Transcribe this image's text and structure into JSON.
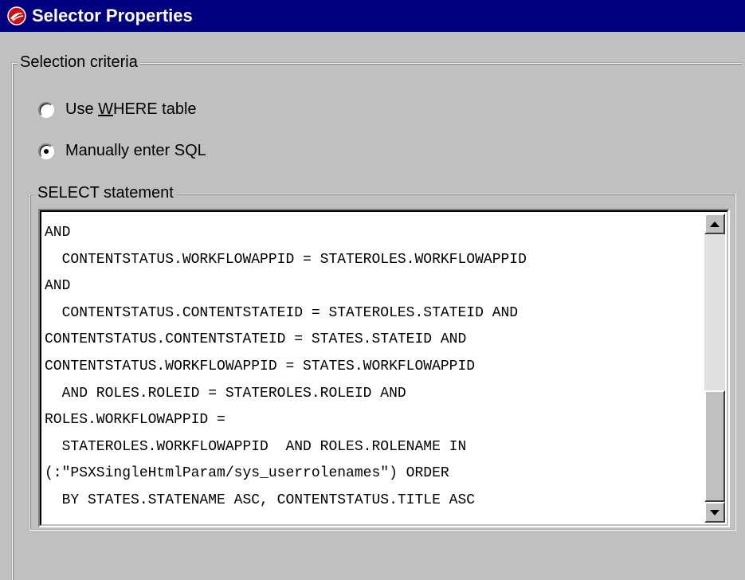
{
  "window": {
    "title": "Selector Properties",
    "icon": "app-logo-icon",
    "title_bar_color": "#000080"
  },
  "selection_criteria": {
    "group_label": "Selection criteria",
    "options": [
      {
        "label_prefix": "Use ",
        "label_mnemonic": "W",
        "label_suffix": "HERE table",
        "checked": false
      },
      {
        "label": "Manually enter SQL",
        "checked": true
      }
    ]
  },
  "select_statement": {
    "group_label": "SELECT statement",
    "lines": [
      "AND",
      "  CONTENTSTATUS.WORKFLOWAPPID = STATEROLES.WORKFLOWAPPID",
      "AND",
      "  CONTENTSTATUS.CONTENTSTATEID = STATEROLES.STATEID AND",
      "CONTENTSTATUS.CONTENTSTATEID = STATES.STATEID AND",
      "CONTENTSTATUS.WORKFLOWAPPID = STATES.WORKFLOWAPPID",
      "  AND ROLES.ROLEID = STATEROLES.ROLEID AND",
      "ROLES.WORKFLOWAPPID =",
      "  STATEROLES.WORKFLOWAPPID  AND ROLES.ROLENAME IN",
      "(:\"PSXSingleHtmlParam/sys_userrolenames\") ORDER",
      "  BY STATES.STATENAME ASC, CONTENTSTATUS.TITLE ASC"
    ]
  },
  "scrollbar": {
    "up_icon": "scroll-up-arrow-icon",
    "down_icon": "scroll-down-arrow-icon"
  }
}
